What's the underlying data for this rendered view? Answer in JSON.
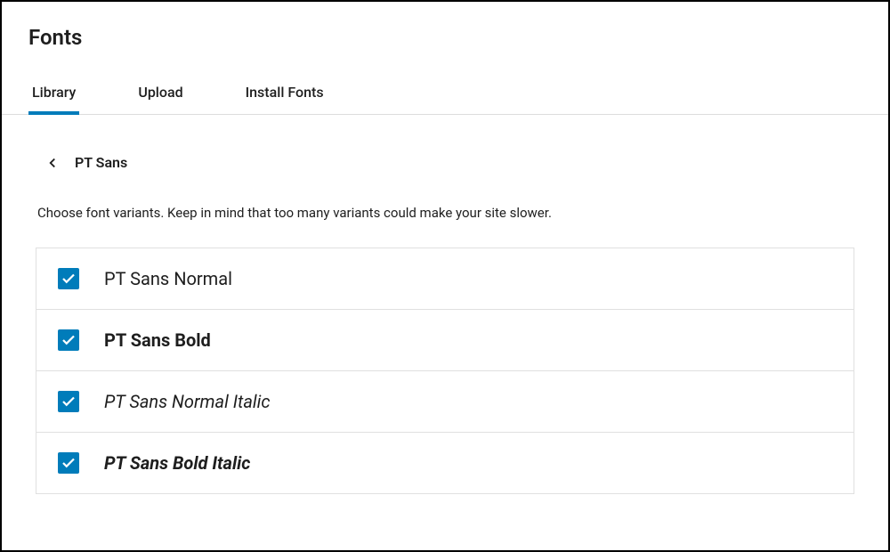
{
  "header": {
    "title": "Fonts"
  },
  "tabs": [
    {
      "label": "Library",
      "active": true
    },
    {
      "label": "Upload",
      "active": false
    },
    {
      "label": "Install Fonts",
      "active": false
    }
  ],
  "breadcrumb": {
    "font_name": "PT Sans"
  },
  "description": "Choose font variants. Keep in mind that too many variants could make your site slower.",
  "variants": [
    {
      "label": "PT Sans Normal",
      "checked": true
    },
    {
      "label": "PT Sans Bold",
      "checked": true
    },
    {
      "label": "PT Sans Normal Italic",
      "checked": true
    },
    {
      "label": "PT Sans Bold Italic",
      "checked": true
    }
  ],
  "colors": {
    "accent": "#007cba"
  }
}
